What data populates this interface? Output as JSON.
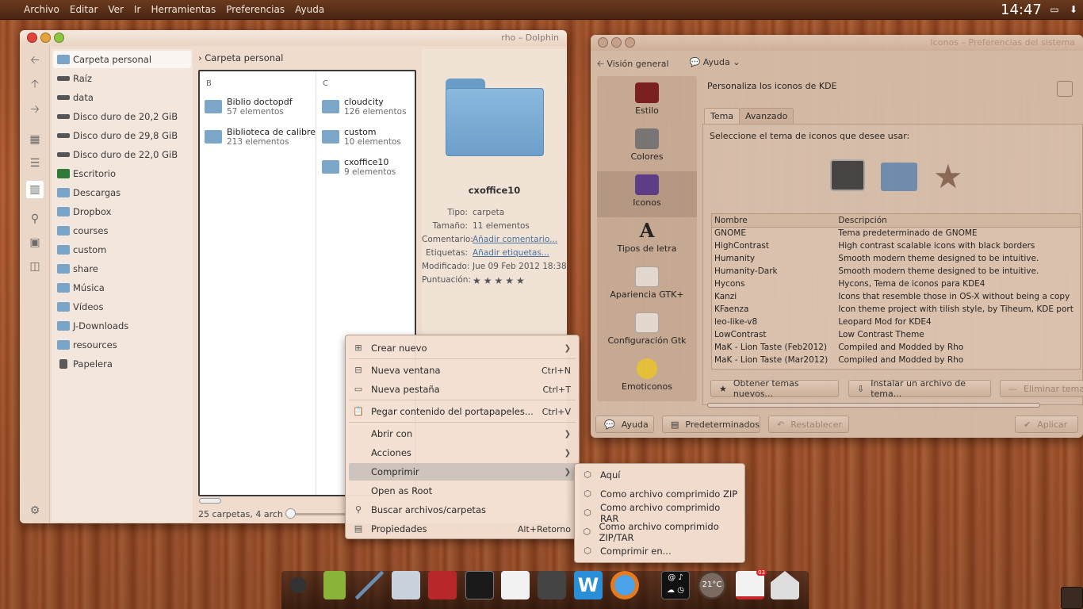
{
  "top_panel": {
    "menu": [
      "Archivo",
      "Editar",
      "Ver",
      "Ir",
      "Herramientas",
      "Preferencias",
      "Ayuda"
    ],
    "clock": "14:47"
  },
  "dolphin": {
    "title": "rho – Dolphin",
    "places": [
      {
        "label": "Carpeta personal",
        "icon": "home-folder-icon"
      },
      {
        "label": "Raíz",
        "icon": "drive-icon"
      },
      {
        "label": "data",
        "icon": "drive-icon"
      },
      {
        "label": "Disco duro de 20,2 GiB",
        "icon": "drive-icon"
      },
      {
        "label": "Disco duro de 29,8 GiB",
        "icon": "drive-icon"
      },
      {
        "label": "Disco duro de 22,0 GiB",
        "icon": "drive-icon"
      },
      {
        "label": "Escritorio",
        "icon": "desktop-icon"
      },
      {
        "label": "Descargas",
        "icon": "folder-icon"
      },
      {
        "label": "Dropbox",
        "icon": "folder-icon"
      },
      {
        "label": "courses",
        "icon": "folder-icon"
      },
      {
        "label": "custom",
        "icon": "folder-icon"
      },
      {
        "label": "share",
        "icon": "folder-icon"
      },
      {
        "label": "Música",
        "icon": "folder-icon"
      },
      {
        "label": "Vídeos",
        "icon": "folder-icon"
      },
      {
        "label": "J-Downloads",
        "icon": "folder-icon"
      },
      {
        "label": "resources",
        "icon": "folder-icon"
      },
      {
        "label": "Papelera",
        "icon": "trash-icon"
      }
    ],
    "breadcrumb": "Carpeta personal",
    "columns": [
      {
        "header": "B",
        "items": [
          {
            "name": "Biblio doctopdf",
            "count": "57 elementos"
          },
          {
            "name": "Biblioteca de calibre",
            "count": "213 elementos"
          }
        ]
      },
      {
        "header": "C",
        "items": [
          {
            "name": "cloudcity",
            "count": "126 elementos"
          },
          {
            "name": "custom",
            "count": "10 elementos"
          },
          {
            "name": "cxoffice10",
            "count": "9 elementos"
          }
        ]
      }
    ],
    "status": "25 carpetas, 4 arch",
    "info": {
      "name": "cxoffice10",
      "rows": [
        {
          "k": "Tipo:",
          "v": "carpeta"
        },
        {
          "k": "Tamaño:",
          "v": "11 elementos"
        },
        {
          "k": "Comentario:",
          "v": "Añadir comentario..."
        },
        {
          "k": "Etiquetas:",
          "v": "Añadir etiquetas..."
        },
        {
          "k": "Modificado:",
          "v": "Jue 09 Feb 2012 18:38"
        },
        {
          "k": "Puntuación:",
          "v": "★★★★★"
        }
      ]
    }
  },
  "settings": {
    "title": "Iconos – Preferencias del sistema",
    "toolbar": {
      "overview": "Visión general",
      "help": "Ayuda"
    },
    "categories": [
      "Estilo",
      "Colores",
      "Iconos",
      "Tipos de letra",
      "Apariencia GTK+",
      "Configuración Gtk",
      "Emoticonos"
    ],
    "heading": "Personaliza los iconos de KDE",
    "tabs": [
      "Tema",
      "Avanzado"
    ],
    "prompt": "Seleccione el tema de iconos que desee usar:",
    "table": {
      "headers": [
        "Nombre",
        "Descripción"
      ],
      "rows": [
        [
          "GNOME",
          "Tema predeterminado de GNOME"
        ],
        [
          "HighContrast",
          "High contrast scalable icons with black borders"
        ],
        [
          "Humanity",
          "Smooth modern theme designed to be intuitive."
        ],
        [
          "Humanity-Dark",
          "Smooth modern theme designed to be intuitive."
        ],
        [
          "Hycons",
          "Hycons, Tema de iconos para KDE4"
        ],
        [
          "Kanzi",
          "Icons that resemble those in OS-X without being a copy"
        ],
        [
          "KFaenza",
          "Icon theme project with tilish style, by Tiheum, KDE port"
        ],
        [
          "leo-like-v8",
          "Leopard Mod for KDE4"
        ],
        [
          "LowContrast",
          "Low Contrast Theme"
        ],
        [
          "MaK - Lion Taste (Feb2012)",
          "Compiled and Modded by Rho"
        ],
        [
          "MaK - Lion Taste (Mar2012)",
          "Compiled and Modded by Rho"
        ]
      ]
    },
    "buttons": {
      "get_new": "Obtener temas nuevos...",
      "install": "Instalar un archivo de tema...",
      "remove": "Eliminar tema"
    },
    "footer": {
      "help": "Ayuda",
      "defaults": "Predeterminados",
      "reset": "Restablecer",
      "apply": "Aplicar"
    }
  },
  "context_menu": {
    "items": [
      {
        "label": "Crear nuevo",
        "shortcut": "",
        "submenu": true
      },
      {
        "label": "Nueva ventana",
        "shortcut": "Ctrl+N"
      },
      {
        "label": "Nueva pestaña",
        "shortcut": "Ctrl+T"
      },
      {
        "label": "Pegar contenido del portapapeles...",
        "shortcut": "Ctrl+V"
      },
      {
        "label": "Abrir con",
        "shortcut": "",
        "submenu": true
      },
      {
        "label": "Acciones",
        "shortcut": "",
        "submenu": true
      },
      {
        "label": "Comprimir",
        "shortcut": "",
        "submenu": true
      },
      {
        "label": "Open as Root",
        "shortcut": ""
      },
      {
        "label": "Buscar archivos/carpetas",
        "shortcut": ""
      },
      {
        "label": "Propiedades",
        "shortcut": "Alt+Retorno"
      }
    ],
    "submenu": [
      "Aquí",
      "Como archivo comprimido ZIP",
      "Como archivo comprimido RAR",
      "Como archivo comprimido ZIP/TAR",
      "Comprimir en..."
    ]
  },
  "dock": {
    "weather": "21°C",
    "mail_badge": "03"
  }
}
